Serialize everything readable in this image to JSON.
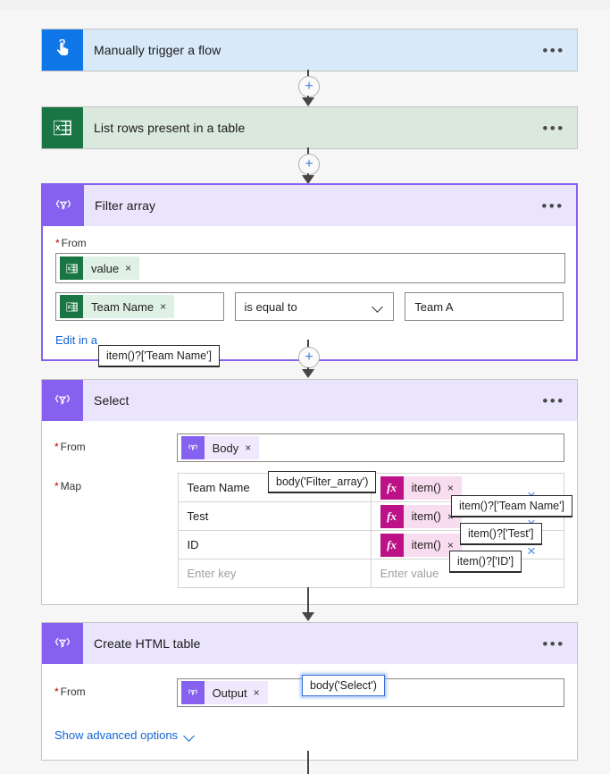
{
  "flow": {
    "steps": [
      {
        "id": "trigger",
        "title": "Manually trigger a flow",
        "icon": "touch-trigger-icon",
        "icon_glyph": "☝",
        "menu": "•••",
        "header_color": "#d8e9f9",
        "icon_color": "#0f76e8"
      },
      {
        "id": "list-rows",
        "title": "List rows present in a table",
        "icon": "excel-icon",
        "menu": "•••",
        "header_color": "#dbe8dd",
        "icon_color": "#1a7544"
      },
      {
        "id": "filter-array",
        "title": "Filter array",
        "icon": "data-operation-icon",
        "menu": "•••",
        "header_color": "#eae4fd",
        "icon_color": "#8661ef",
        "selected": true
      },
      {
        "id": "select",
        "title": "Select",
        "icon": "data-operation-icon",
        "menu": "•••",
        "header_color": "#eae4fd",
        "icon_color": "#8661ef"
      },
      {
        "id": "create-html-table",
        "title": "Create HTML table",
        "icon": "data-operation-icon",
        "menu": "•••",
        "header_color": "#eae4fd",
        "icon_color": "#8661ef"
      }
    ]
  },
  "filter_array": {
    "from_label": "From",
    "from_token": {
      "text": "value",
      "remove": "×",
      "icon": "excel-icon"
    },
    "condition": {
      "left_token": {
        "text": "Team Name",
        "remove": "×",
        "icon": "excel-icon"
      },
      "operator": "is equal to",
      "operator_chevron": "chevron-down-icon",
      "right_value": "Team A"
    },
    "tooltip": "item()?['Team Name']",
    "edit_link": "Edit in a"
  },
  "select": {
    "from_label": "From",
    "from_token": {
      "text": "Body",
      "remove": "×",
      "icon": "data-operation-icon"
    },
    "from_tooltip": "body('Filter_array')",
    "map_label": "Map",
    "map_rows": [
      {
        "key": "Team Name",
        "value_token": "item()",
        "remove": "×",
        "tooltip": "item()?['Team Name']",
        "delete": "×"
      },
      {
        "key": "Test",
        "value_token": "item()",
        "remove": "×",
        "tooltip": "item()?['Test']",
        "delete": "×"
      },
      {
        "key": "ID",
        "value_token": "item()",
        "remove": "×",
        "tooltip": "item()?['ID']",
        "delete": "×"
      }
    ],
    "key_placeholder": "Enter key",
    "value_placeholder": "Enter value"
  },
  "create_html_table": {
    "from_label": "From",
    "from_token": {
      "text": "Output",
      "remove": "×",
      "icon": "data-operation-icon"
    },
    "from_tooltip": "body('Select')",
    "advanced_link": "Show advanced options",
    "advanced_chevron": "chevron-down-icon"
  },
  "connectors": {
    "add_glyph": "+",
    "labels": [
      "add-step-trigger-to-list",
      "add-step-list-to-filter",
      "add-step-filter-to-select"
    ]
  }
}
